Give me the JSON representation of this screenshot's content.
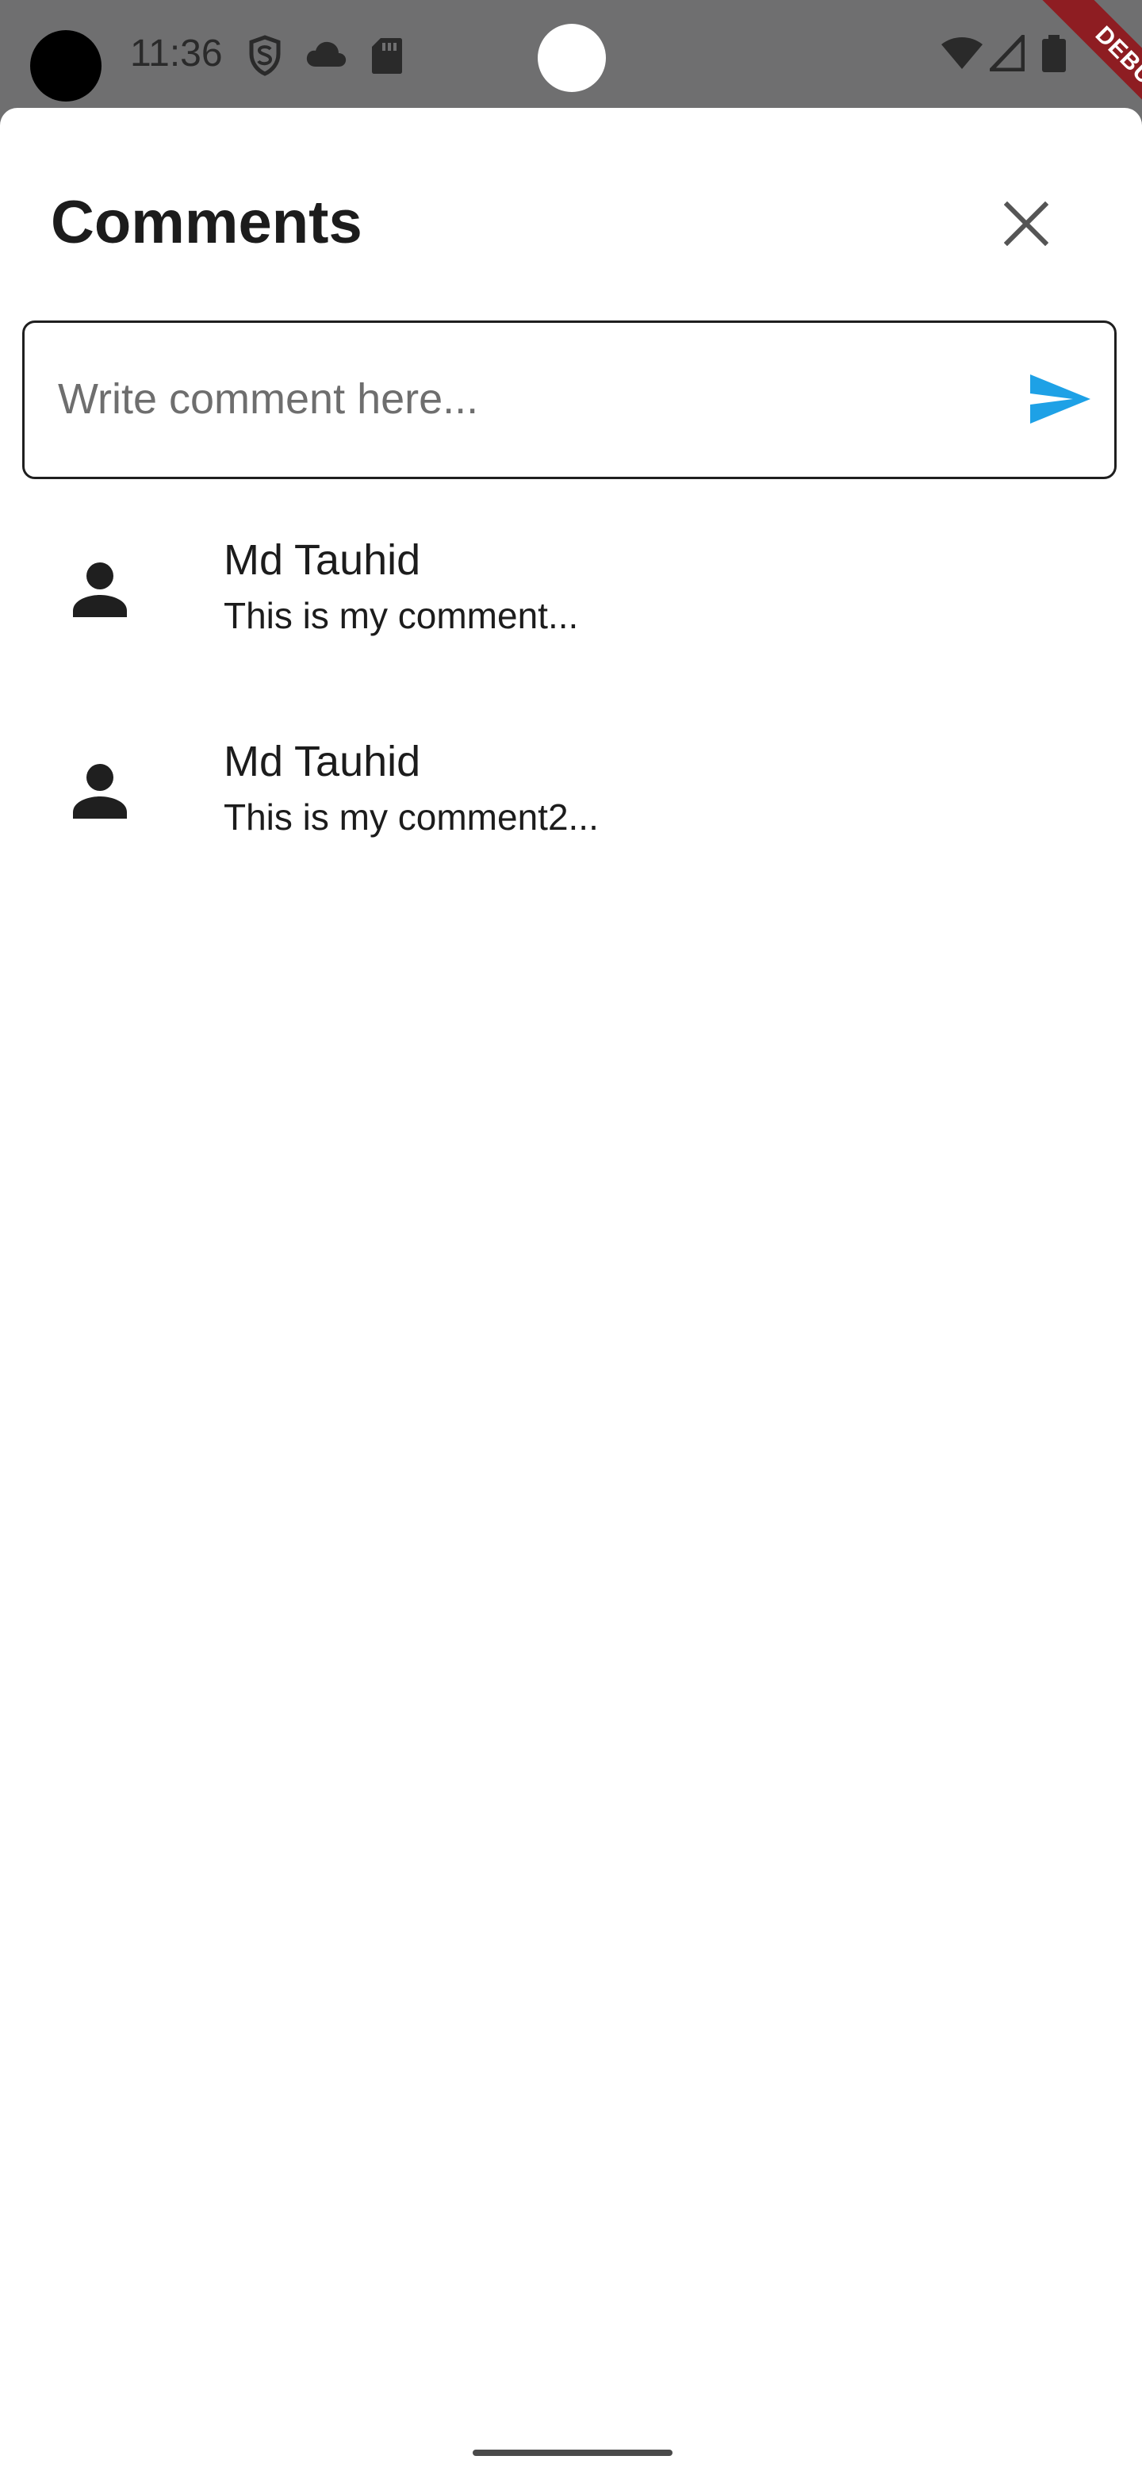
{
  "status_bar": {
    "time": "11:36",
    "icons": [
      "shield-s-icon",
      "cloud-icon",
      "sd-card-icon",
      "wifi-icon",
      "signal-icon",
      "battery-icon"
    ]
  },
  "debug_banner": {
    "label": "DEBUG",
    "color": "#8e1d22"
  },
  "sheet": {
    "title": "Comments",
    "close_icon": "close-icon"
  },
  "comment_input": {
    "placeholder": "Write comment here...",
    "value": "",
    "send_icon": "send-icon",
    "send_color": "#1ea1e6"
  },
  "comments": [
    {
      "author": "Md Tauhid",
      "text": "This is my comment...",
      "avatar_icon": "person-icon"
    },
    {
      "author": "Md Tauhid",
      "text": "This is my comment2...",
      "avatar_icon": "person-icon"
    }
  ]
}
